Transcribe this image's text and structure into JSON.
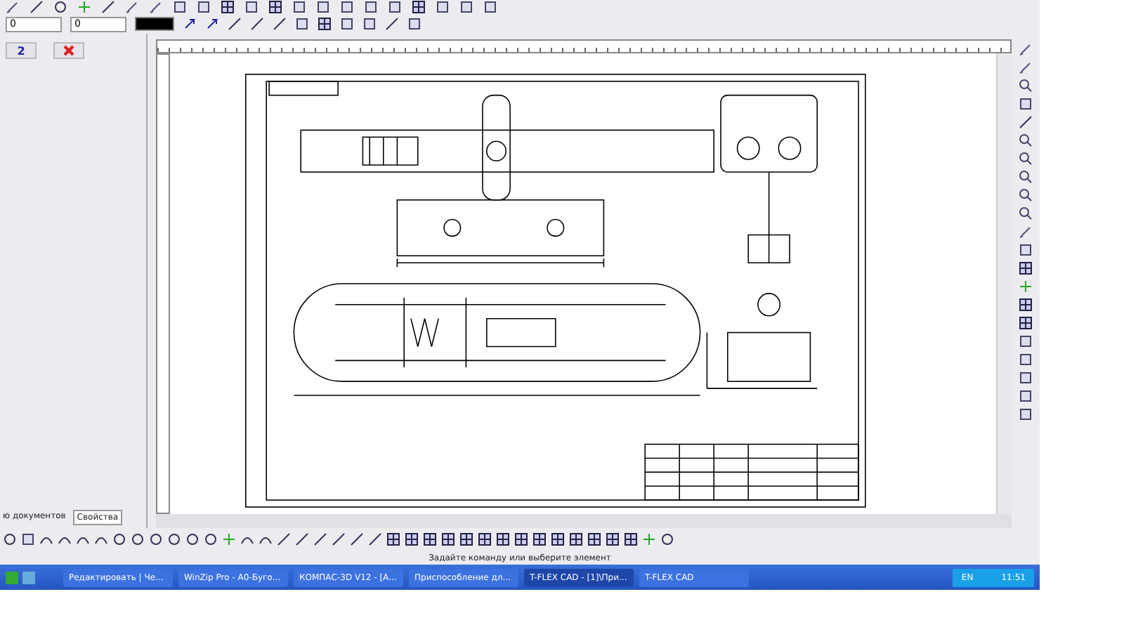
{
  "toolbar": {
    "fields": [
      {
        "value": "0"
      },
      {
        "value": "0"
      }
    ]
  },
  "panel": {
    "button": "2",
    "tabs": [
      {
        "label": "ю документов",
        "selected": false
      },
      {
        "label": "Свойства",
        "selected": true
      }
    ]
  },
  "status_bar": {
    "message": "Задайте команду или выберите элемент"
  },
  "taskbar": {
    "items": [
      {
        "label": "Редактировать | Че...",
        "selected": false
      },
      {
        "label": "WinZip Pro - A0-Буго...",
        "selected": false
      },
      {
        "label": "КОМПАС-3D V12 - [А...",
        "selected": false
      },
      {
        "label": "Приспособление дл...",
        "selected": false
      },
      {
        "label": "T-FLEX CAD - [1]\\При...",
        "selected": true
      },
      {
        "label": "T-FLEX CAD",
        "selected": false
      }
    ],
    "language": "EN",
    "clock": "11:51"
  }
}
